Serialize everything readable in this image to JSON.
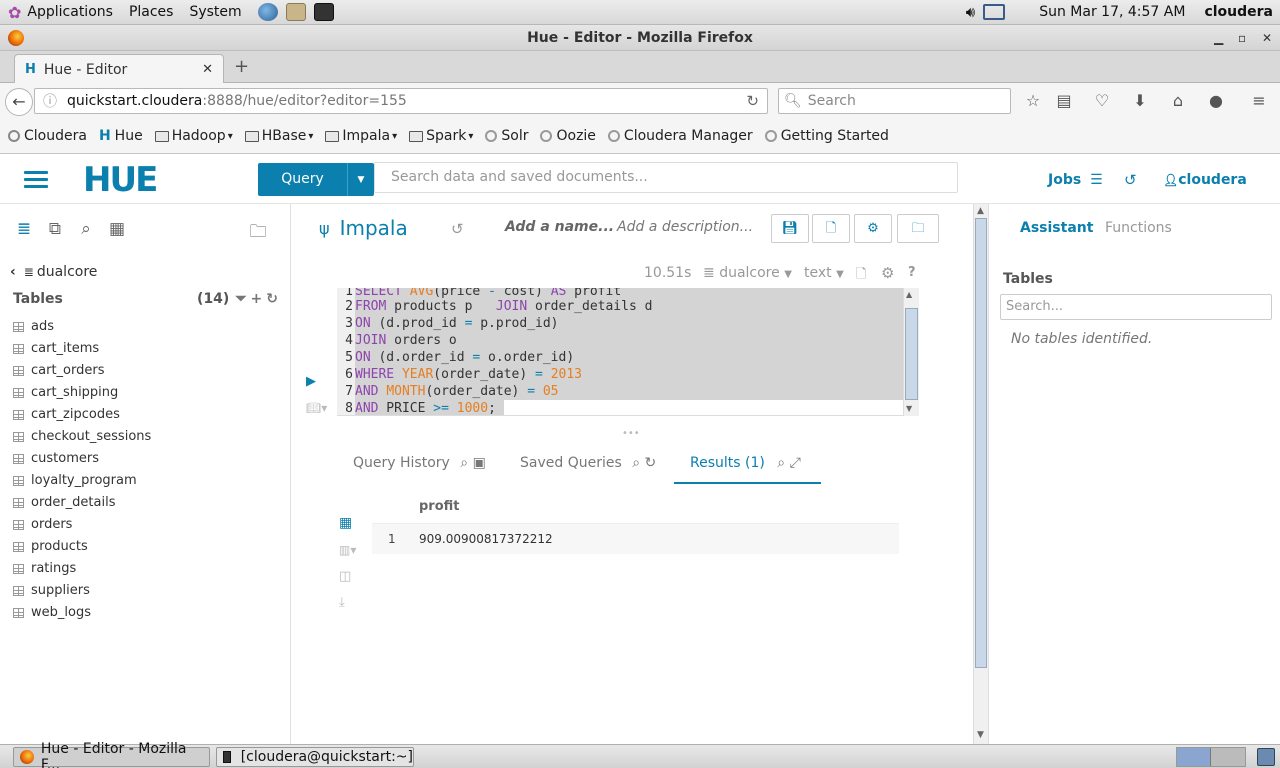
{
  "gnome": {
    "menus": [
      "Applications",
      "Places",
      "System"
    ],
    "clock": "Sun Mar 17,  4:57 AM",
    "user": "cloudera"
  },
  "window": {
    "title": "Hue - Editor - Mozilla Firefox"
  },
  "browser": {
    "tab_title": "Hue - Editor",
    "url_host": "quickstart.cloudera",
    "url_rest": ":8888/hue/editor?editor=155",
    "search_placeholder": "Search",
    "bookmarks": [
      {
        "label": "Cloudera",
        "kind": "site"
      },
      {
        "label": "Hue",
        "kind": "site"
      },
      {
        "label": "Hadoop",
        "kind": "folder"
      },
      {
        "label": "HBase",
        "kind": "folder"
      },
      {
        "label": "Impala",
        "kind": "folder"
      },
      {
        "label": "Spark",
        "kind": "folder"
      },
      {
        "label": "Solr",
        "kind": "site"
      },
      {
        "label": "Oozie",
        "kind": "site"
      },
      {
        "label": "Cloudera Manager",
        "kind": "site"
      },
      {
        "label": "Getting Started",
        "kind": "site"
      }
    ]
  },
  "hue": {
    "logo": "HUE",
    "query_button": "Query",
    "global_search_placeholder": "Search data and saved documents...",
    "jobs": "Jobs",
    "username": "cloudera"
  },
  "left": {
    "database": "dualcore",
    "tables_label": "Tables",
    "tables_count": "(14)",
    "tables": [
      "ads",
      "cart_items",
      "cart_orders",
      "cart_shipping",
      "cart_zipcodes",
      "checkout_sessions",
      "customers",
      "loyalty_program",
      "order_details",
      "orders",
      "products",
      "ratings",
      "suppliers",
      "web_logs"
    ]
  },
  "editor": {
    "engine": "Impala",
    "name_placeholder": "Add a name...",
    "desc_placeholder": "Add a description...",
    "duration": "10.51s",
    "db": "dualcore",
    "format": "text",
    "code_lines": [
      "SELECT AVG(price - cost) AS profit",
      "FROM products p   JOIN order_details d",
      "ON (d.prod_id = p.prod_id)",
      "JOIN orders o",
      "ON (d.order_id = o.order_id)",
      "WHERE YEAR(order_date) = 2013",
      "AND MONTH(order_date) = 05",
      "AND PRICE >= 1000;"
    ]
  },
  "results": {
    "tabs": [
      "Query History",
      "Saved Queries",
      "Results (1)"
    ],
    "columns": [
      "profit"
    ],
    "rows": [
      {
        "index": "1",
        "profit": "909.00900817372212"
      }
    ]
  },
  "assistant": {
    "tabs": [
      "Assistant",
      "Functions"
    ],
    "tables_label": "Tables",
    "search_placeholder": "Search...",
    "empty_msg": "No tables identified."
  },
  "taskbar": {
    "items": [
      "Hue - Editor - Mozilla F...",
      "[cloudera@quickstart:~]"
    ]
  }
}
